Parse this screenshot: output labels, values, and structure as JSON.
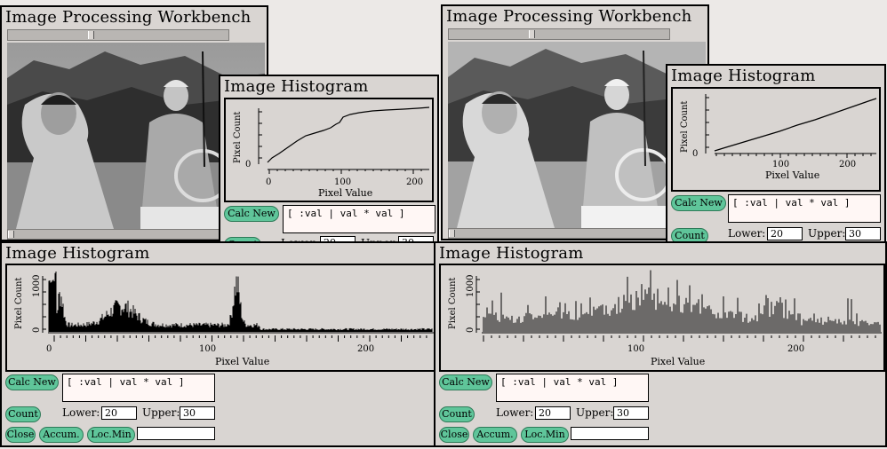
{
  "workbench": {
    "title": "Image Processing Workbench"
  },
  "histogram": {
    "title": "Image Histogram",
    "ylabel": "Pixel Count",
    "xlabel": "Pixel Value",
    "ytick": "1000",
    "zero": "0",
    "xticks": [
      "0",
      "100",
      "200"
    ],
    "xticks_small": [
      "100",
      "200"
    ],
    "ytick_small": "0",
    "expression": "[ :val | val * val ]",
    "calc_new_label": "Calc New",
    "count_label": "Count",
    "lower_label": "Lower:",
    "upper_label": "Upper:",
    "lower_value": "20",
    "upper_value": "30",
    "close_label": "Close",
    "accum_label": "Accum.",
    "locmin_label": "Loc.Min"
  }
}
